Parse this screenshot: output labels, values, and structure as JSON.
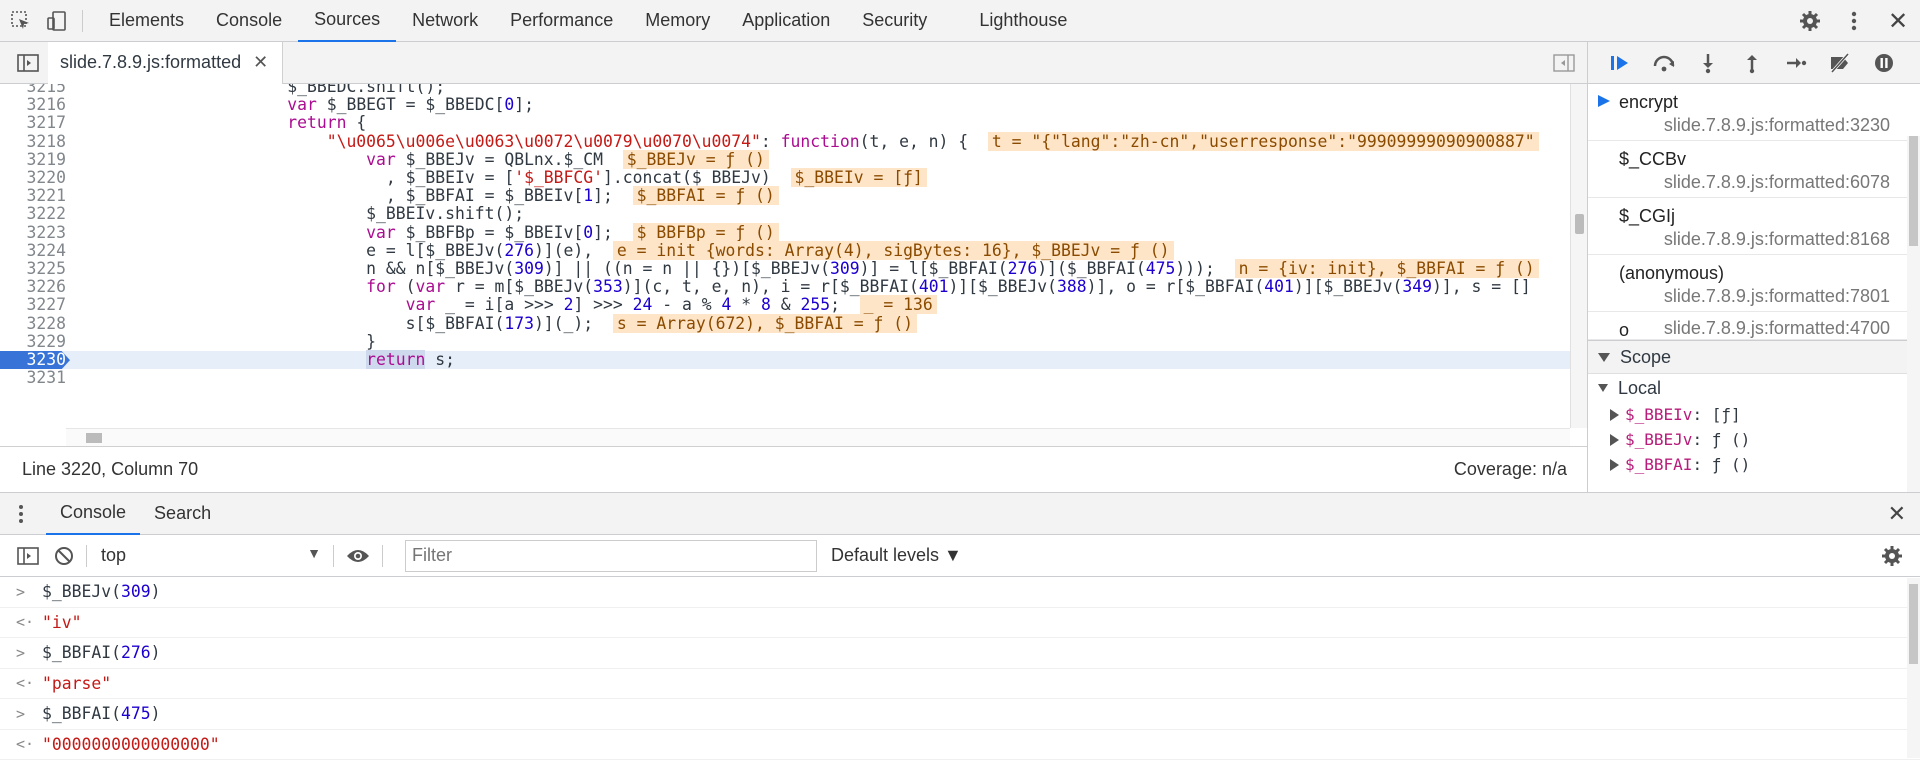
{
  "tabs": [
    "Elements",
    "Console",
    "Sources",
    "Network",
    "Performance",
    "Memory",
    "Application",
    "Security",
    "Lighthouse"
  ],
  "active_tab": "Sources",
  "file_tab": {
    "name": "slide.7.8.9.js:formatted"
  },
  "code_lines": [
    {
      "num": "3215",
      "html": "<span>$_BBEDC.shift();</span>",
      "indent": "                     "
    },
    {
      "num": "3216",
      "html": "<span class=\"kw\">var</span> $_BBEGT = $_BBEDC[<span class=\"num\">0</span>];",
      "indent": "                     "
    },
    {
      "num": "3217",
      "html": "<span class=\"kw\">return</span> {",
      "indent": "                     "
    },
    {
      "num": "3218",
      "html": "<span class=\"str\">\"\\u0065\\u006e\\u0063\\u0072\\u0079\\u0070\\u0074\"</span>: <span class=\"kw\">function</span>(t, e, n) {  <span class=\"ann\">t = \"{\"lang\":\"zh-cn\",\"userresponse\":\"99909999090900887\"</span>",
      "indent": "                         "
    },
    {
      "num": "3219",
      "html": "<span class=\"kw\">var</span> $_BBEJv = QBLnx.$_CM  <span class=\"ann\">$_BBEJv = ƒ ()</span>",
      "indent": "                             "
    },
    {
      "num": "3220",
      "html": "  , $_BBEIv = [<span class=\"str\">'$_BBFCG'</span>].concat($_BBEJv)  <span class=\"ann\">$_BBEIv = [ƒ]</span>",
      "indent": "                             "
    },
    {
      "num": "3221",
      "html": "  , $_BBFAI = $_BBEIv[<span class=\"num\">1</span>];  <span class=\"ann\">$_BBFAI = ƒ ()</span>",
      "indent": "                             "
    },
    {
      "num": "3222",
      "html": "$_BBEIv.shift();",
      "indent": "                             "
    },
    {
      "num": "3223",
      "html": "<span class=\"kw\">var</span> $_BBFBp = $_BBEIv[<span class=\"num\">0</span>];  <span class=\"ann\">$_BBFBp = ƒ ()</span>",
      "indent": "                             "
    },
    {
      "num": "3224",
      "html": "e = l[$_BBEJv(<span class=\"num\">276</span>)](e),  <span class=\"ann\">e = init {words: Array(4), sigBytes: 16}, $_BBEJv = ƒ ()</span>",
      "indent": "                             "
    },
    {
      "num": "3225",
      "html": "n &amp;&amp; n[$_BBEJv(<span class=\"num\">309</span>)] || ((n = n || {})[$_BBEJv(<span class=\"num\">309</span>)] = l[$_BBFAI(<span class=\"num\">276</span>)]($_BBFAI(<span class=\"num\">475</span>)));  <span class=\"ann\">n = {iv: init}, $_BBFAI = ƒ ()</span>",
      "indent": "                             "
    },
    {
      "num": "3226",
      "html": "<span class=\"kw\">for</span> (<span class=\"kw\">var</span> r = m[$_BBEJv(<span class=\"num\">353</span>)](c, t, e, n), i = r[$_BBFAI(<span class=\"num\">401</span>)][$_BBEJv(<span class=\"num\">388</span>)], o = r[$_BBFAI(<span class=\"num\">401</span>)][$_BBEJv(<span class=\"num\">349</span>)], s = []",
      "indent": "                             "
    },
    {
      "num": "3227",
      "html": "<span class=\"kw\">var</span> _ = i[a &gt;&gt;&gt; <span class=\"num\">2</span>] &gt;&gt;&gt; <span class=\"num\">24</span> - a % <span class=\"num\">4</span> * <span class=\"num\">8</span> &amp; <span class=\"num\">255</span>;  <span class=\"ann\">_ = 136</span>",
      "indent": "                                 "
    },
    {
      "num": "3228",
      "html": "s[$_BBFAI(<span class=\"num\">173</span>)](_);  <span class=\"ann\">s = Array(672), $_BBFAI = ƒ ()</span>",
      "indent": "                                 "
    },
    {
      "num": "3229",
      "html": "}",
      "indent": "                             "
    },
    {
      "num": "3230",
      "html": "<span class=\"kw\" style=\"background:#cfd9ee\">return</span> s;",
      "indent": "                             ",
      "current": true
    },
    {
      "num": "3231",
      "html": "",
      "indent": ""
    }
  ],
  "status": {
    "position": "Line 3220, Column 70",
    "coverage": "Coverage: n/a"
  },
  "call_stack": [
    {
      "name": "encrypt",
      "location": "slide.7.8.9.js:formatted:3230",
      "active": true
    },
    {
      "name": "$_CCBv",
      "location": "slide.7.8.9.js:formatted:6078"
    },
    {
      "name": "$_CGIj",
      "location": "slide.7.8.9.js:formatted:8168"
    },
    {
      "name": "(anonymous)",
      "location": "slide.7.8.9.js:formatted:7801"
    },
    {
      "name": "o",
      "location": "slide.7.8.9.js:formatted:4700"
    }
  ],
  "scope": {
    "title": "Scope",
    "local_title": "Local",
    "items": [
      {
        "name": "$_BBEIv",
        "value": "[ƒ]"
      },
      {
        "name": "$_BBEJv",
        "value": "ƒ ()"
      },
      {
        "name": "$_BBFAI",
        "value": "ƒ ()"
      }
    ]
  },
  "drawer": {
    "tabs": [
      "Console",
      "Search"
    ],
    "active": "Console",
    "context": "top",
    "filter_placeholder": "Filter",
    "levels": "Default levels ▼"
  },
  "console_lines": [
    {
      "kind": "in",
      "html": "$_BBEJv(<span class=\"num\">309</span>)"
    },
    {
      "kind": "out",
      "html": "<span class=\"str\">\"iv\"</span>"
    },
    {
      "kind": "in",
      "html": "$_BBFAI(<span class=\"num\">276</span>)"
    },
    {
      "kind": "out",
      "html": "<span class=\"str\">\"parse\"</span>"
    },
    {
      "kind": "in",
      "html": "$_BBFAI(<span class=\"num\">475</span>)"
    },
    {
      "kind": "out",
      "html": "<span class=\"str\">\"0000000000000000\"</span>"
    }
  ],
  "colors": {
    "accent": "#1a73e8",
    "annotation_bg": "#ffe5c7",
    "current_line": "#3874d8"
  }
}
